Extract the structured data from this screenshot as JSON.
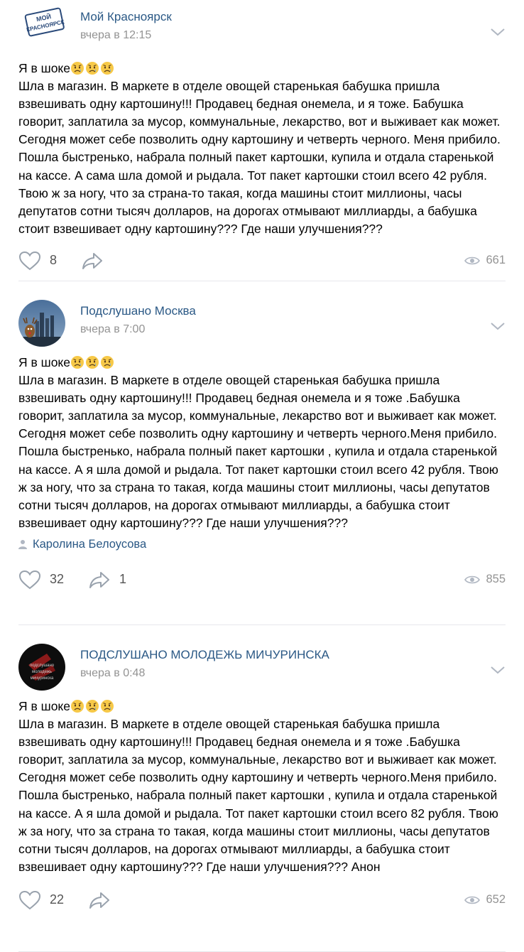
{
  "posts": [
    {
      "author": "Мой Красноярск",
      "avatar_text": "МОЙ КРАСНОЯРСК",
      "time": "вчера в 12:15",
      "lead": "Я в шоке",
      "body": "Шла в магазин. В маркете в отделе овощей старенькая бабушка пришла взвешивать одну картошину!!! Продавец бедная онемела, и я тоже. Бабушка говорит, заплатила за мусор, коммунальные, лекарство, вот и выживает как может. Сегодня может себе позволить одну картошину и четверть черного. Меня прибило. Пошла быстренько, набрала полный пакет картошки, купила и отдала старенькой на кассе. А сама шла домой и рыдала. Тот пакет картошки стоил всего 42 рубля. Твою ж за ногу, что за страна-то такая, когда машины стоит миллионы, часы депутатов сотни тысяч долларов, на дорогах отмывают миллиарды, а бабушка стоит взвешивает одну картошину??? Где наши улучшения???",
      "likes": "8",
      "shares": "",
      "views": "661",
      "signer": ""
    },
    {
      "author": "Подслушано Москва",
      "time": "вчера в 7:00",
      "lead": "Я в шоке",
      "body": "Шла в магазин. В маркете в отделе овощей старенькая бабушка пришла взвешивать одну картошину!!! Продавец бедная онемела и я тоже .Бабушка говорит, заплатила за мусор, коммунальные, лекарство вот и выживает как может. Сегодня может себе позволить одну картошину и четверть черного.Меня прибило. Пошла быстренько, набрала полный пакет картошки , купила и отдала старенькой на кассе. А я шла домой и рыдала. Тот пакет картошки стоил всего 42 рубля. Твою ж за ногу, что за страна то такая, когда машины стоит миллионы, часы депутатов сотни тысяч долларов, на дорогах отмывают миллиарды, а бабушка стоит взвешивает одну картошину??? Где наши улучшения???",
      "likes": "32",
      "shares": "1",
      "views": "855",
      "signer": "Каролина Белоусова"
    },
    {
      "author": "ПОДСЛУШАНО МОЛОДЕЖЬ МИЧУРИНСКА",
      "time": "вчера в 0:48",
      "lead": "Я в шоке",
      "body": "Шла в магазин. В маркете в отделе овощей старенькая бабушка пришла взвешивать одну картошину!!! Продавец бедная онемела и я тоже .Бабушка говорит, заплатила за мусор, коммунальные, лекарство вот и выживает как может. Сегодня может себе позволить одну картошину и четверть черного.Меня прибило. Пошла быстренько, набрала полный пакет картошки , купила и отдала старенькой на кассе. А я шла домой и рыдала. Тот пакет картошки стоил всего 82 рубля. Твою ж за ногу, что за страна то такая, когда машины стоит миллионы, часы депутатов сотни тысяч долларов, на дорогах отмывают миллиарды, а бабушка стоит взвешивает одну картошину??? Где наши улучшения??? Анон",
      "likes": "22",
      "shares": "",
      "views": "652",
      "signer": ""
    }
  ],
  "icons": {
    "like": "heart-icon",
    "share": "share-arrow-icon",
    "views": "eye-icon",
    "menu": "chevron-down-icon",
    "emoji": "sad-face-emoji",
    "signer": "person-icon"
  },
  "colors": {
    "link": "#2a5885",
    "meta": "#939393",
    "divider": "#e7e8ec"
  }
}
